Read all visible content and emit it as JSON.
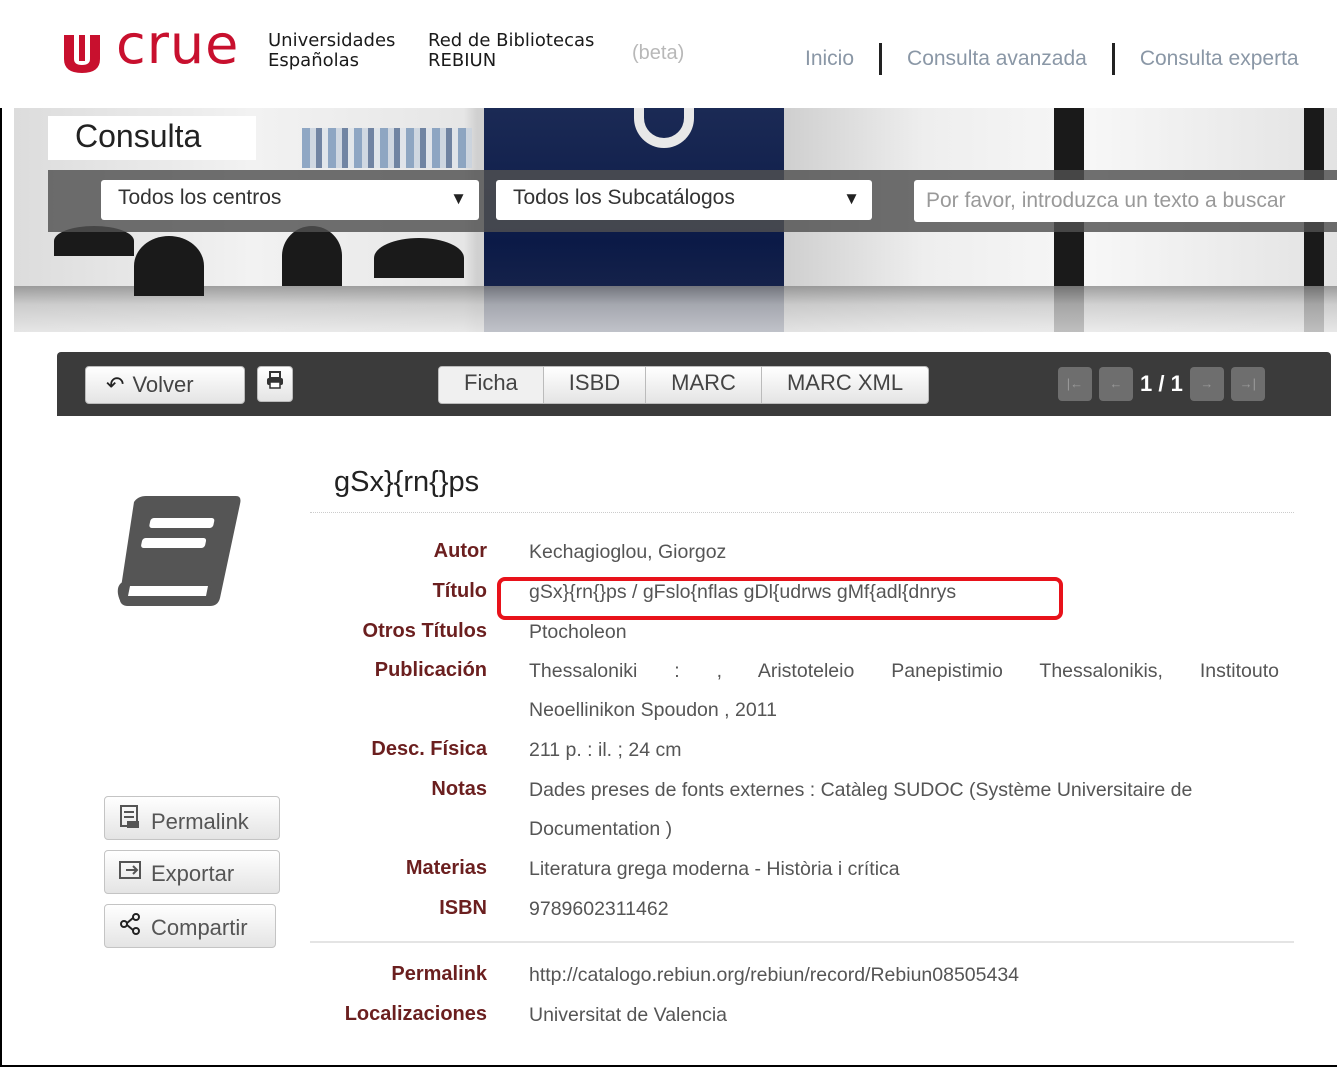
{
  "header": {
    "logo": "crue",
    "org_line1": "Universidades",
    "org_line2": "Españolas",
    "network_line1": "Red de Bibliotecas",
    "network_line2": "REBIUN",
    "beta": "(beta)",
    "nav": [
      "Inicio",
      "Consulta avanzada",
      "Consulta experta"
    ]
  },
  "search": {
    "tab_label": "Consulta",
    "centros_selected": "Todos los centros",
    "subcatalogos_selected": "Todos los Subcatálogos",
    "placeholder": "Por favor, introduzca un texto a buscar"
  },
  "toolbar": {
    "back_label": "Volver",
    "tabs": [
      "Ficha",
      "ISBD",
      "MARC",
      "MARC XML"
    ],
    "page_count": "1 / 1"
  },
  "record": {
    "title": "gSx}{rn{}ps",
    "fields": {
      "autor_label": "Autor",
      "autor": "Kechagioglou, Giorgoz",
      "titulo_label": "Título",
      "titulo": "gSx}{rn{}ps / gFslo{nflas gDl{udrws gMf{adl{dnrys",
      "otros_label": "Otros Títulos",
      "otros": "Ptocholeon",
      "publicacion_label": "Publicación",
      "publicacion_1": "Thessaloniki : , Aristoteleio Panepistimio Thessalonikis, Institouto",
      "publicacion_2": "Neoellinikon Spoudon , 2011",
      "desc_label": "Desc. Física",
      "desc": "211 p. : il. ; 24 cm",
      "notas_label": "Notas",
      "notas_1": "Dades preses de fonts externes : Catàleg SUDOC (Système Universitaire de",
      "notas_2": "Documentation )",
      "materias_label": "Materias",
      "materias": "Literatura grega moderna - Història i crítica",
      "isbn_label": "ISBN",
      "isbn": "9789602311462",
      "permalink_label": "Permalink",
      "permalink": "http://catalogo.rebiun.org/rebiun/record/Rebiun08505434",
      "localizaciones_label": "Localizaciones",
      "localizaciones": "Universitat de Valencia"
    }
  },
  "side_actions": [
    "Permalink",
    "Exportar",
    "Compartir"
  ],
  "colors": {
    "brand_red": "#c8102e",
    "label_color": "#6b1f1f",
    "highlight_border": "#e8121a",
    "toolbar_bg": "#3b3b3b"
  }
}
